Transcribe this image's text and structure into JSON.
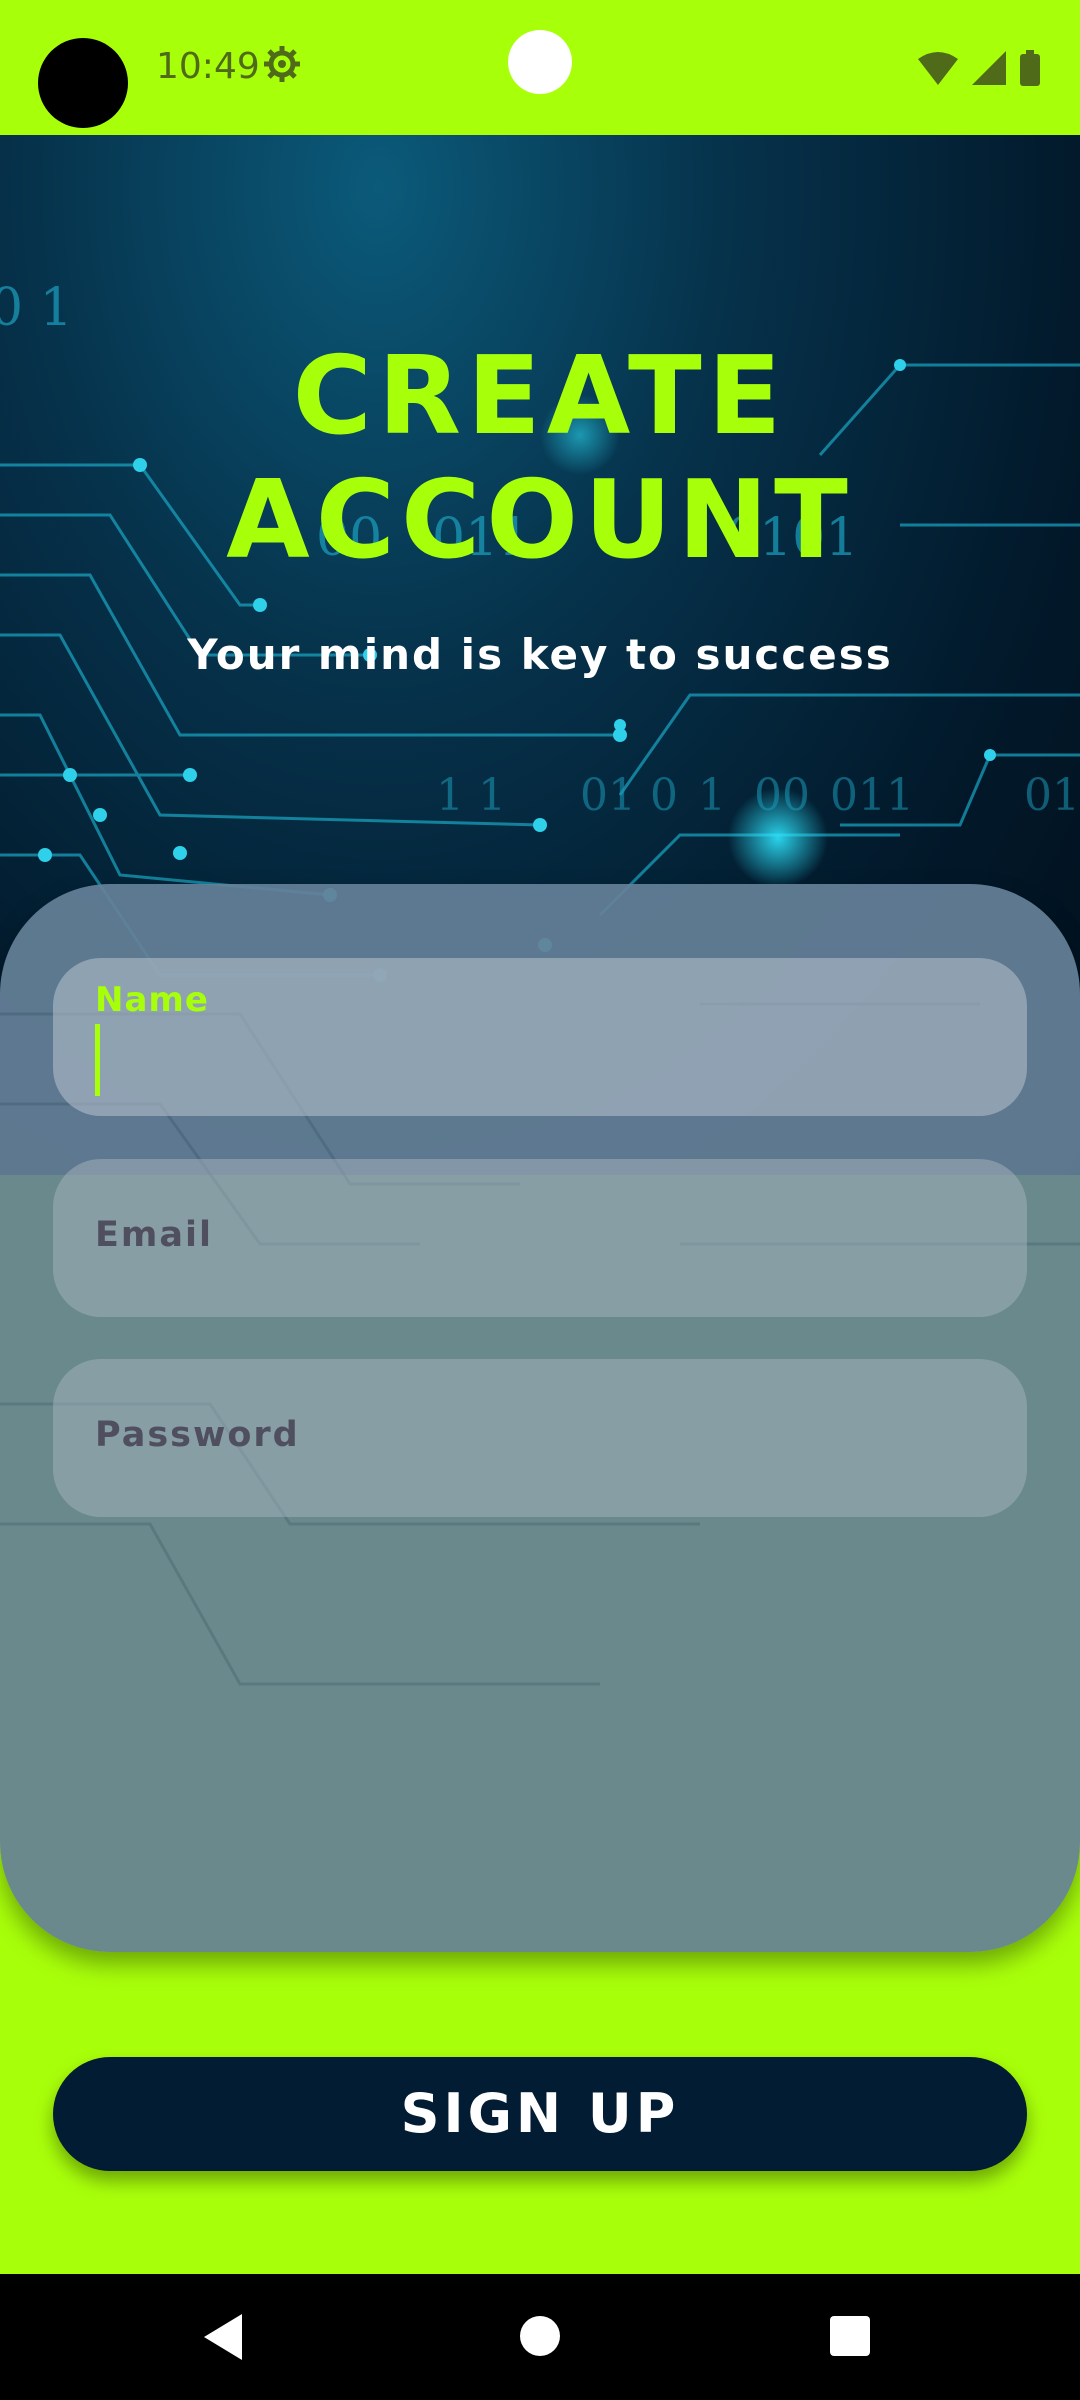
{
  "status_bar": {
    "time": "10:49",
    "icons": [
      "settings-gear-icon",
      "wifi-icon",
      "cell-signal-icon",
      "battery-icon"
    ]
  },
  "hero": {
    "title": "CREATE ACCOUNT",
    "subtitle": "Your mind is key to success",
    "background_text": [
      "0 1",
      "00",
      "011",
      "0101",
      "1 1",
      "01",
      "0",
      "1",
      "00",
      "011",
      "010"
    ]
  },
  "form": {
    "name": {
      "label": "Name",
      "value": "",
      "focused": true
    },
    "email": {
      "placeholder": "Email",
      "value": ""
    },
    "password": {
      "placeholder": "Password",
      "value": ""
    }
  },
  "signup_button": {
    "label": "SIGN UP"
  },
  "nav_bar": {
    "icons": [
      "back-icon",
      "home-icon",
      "recents-icon"
    ]
  },
  "colors": {
    "accent": "#a8ff0a",
    "button_bg": "#021c33",
    "card_bg": "#647f98",
    "placeholder_text": "#4f4f5f"
  }
}
